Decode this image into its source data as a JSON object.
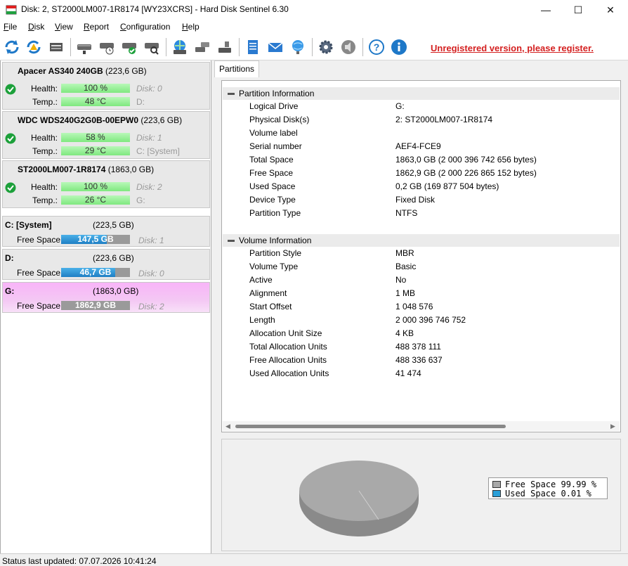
{
  "window": {
    "title": "Disk: 2, ST2000LM007-1R8174 [WY23XCRS]  -  Hard Disk Sentinel 6.30",
    "minimize_glyph": "—",
    "maximize_glyph": "☐",
    "close_glyph": "✕"
  },
  "menu": [
    {
      "first": "F",
      "rest": "ile"
    },
    {
      "first": "D",
      "rest": "isk"
    },
    {
      "first": "V",
      "rest": "iew"
    },
    {
      "first": "R",
      "rest": "eport"
    },
    {
      "first": "C",
      "rest": "onfiguration"
    },
    {
      "first": "H",
      "rest": "elp"
    }
  ],
  "toolbar": {
    "icons": [
      "refresh-icon",
      "refresh-warning-icon",
      "drive-icon",
      "disk-test-icon",
      "disk-schedule-icon",
      "disk-ok-icon",
      "disk-search-icon",
      "disk-globe-icon",
      "disk-export-icon",
      "disk-ide-icon",
      "report-icon",
      "email-icon",
      "network-icon",
      "settings-icon",
      "sound-icon",
      "help-icon",
      "info-icon"
    ],
    "register_text": "Unregistered version, please register."
  },
  "disks": [
    {
      "name": "Apacer AS340 240GB",
      "size": "(223,6 GB)",
      "health_label": "Health:",
      "health": "100 %",
      "health_pct": 100,
      "temp_label": "Temp.:",
      "temp": "48 °C",
      "disk_no": "Disk: 0",
      "letter": "D:"
    },
    {
      "name": "WDC WDS240G2G0B-00EPW0",
      "size": "(223,6 GB)",
      "health_label": "Health:",
      "health": "58 %",
      "health_pct": 58,
      "temp_label": "Temp.:",
      "temp": "29 °C",
      "disk_no": "Disk: 1",
      "letter": "C: [System]"
    },
    {
      "name": "ST2000LM007-1R8174",
      "size": "(1863,0 GB)",
      "health_label": "Health:",
      "health": "100 %",
      "health_pct": 100,
      "temp_label": "Temp.:",
      "temp": "26 °C",
      "disk_no": "Disk: 2",
      "letter": "G:"
    }
  ],
  "partitions": [
    {
      "name": "C: [System]",
      "size": "(223,5 GB)",
      "free_label": "Free Space",
      "free": "147,5 GB",
      "free_fraction": 0.66,
      "disk": "Disk: 1",
      "selected": false
    },
    {
      "name": "D:",
      "size": "(223,6 GB)",
      "free_label": "Free Space",
      "free": "46,7 GB",
      "free_fraction": 0.79,
      "disk": "Disk: 0",
      "selected": false
    },
    {
      "name": "G:",
      "size": "(1863,0 GB)",
      "free_label": "Free Space",
      "free": "1862,9 GB",
      "free_fraction": 0.0,
      "disk": "Disk: 2",
      "selected": true
    }
  ],
  "tab": "Partitions",
  "partition_info": {
    "header": "Partition Information",
    "rows": [
      {
        "k": "Logical Drive",
        "v": "G:"
      },
      {
        "k": "Physical Disk(s)",
        "v": "2: ST2000LM007-1R8174"
      },
      {
        "k": "Volume label",
        "v": ""
      },
      {
        "k": "Serial number",
        "v": "AEF4-FCE9"
      },
      {
        "k": "Total Space",
        "v": "1863,0 GB (2 000 396 742 656 bytes)"
      },
      {
        "k": "Free Space",
        "v": "1862,9 GB (2 000 226 865 152 bytes)"
      },
      {
        "k": "Used Space",
        "v": "0,2 GB (169 877 504 bytes)"
      },
      {
        "k": "Device Type",
        "v": "Fixed Disk"
      },
      {
        "k": "Partition Type",
        "v": "NTFS"
      }
    ]
  },
  "volume_info": {
    "header": "Volume Information",
    "rows": [
      {
        "k": "Partition Style",
        "v": "MBR"
      },
      {
        "k": "Volume Type",
        "v": "Basic"
      },
      {
        "k": "Active",
        "v": "No"
      },
      {
        "k": "Alignment",
        "v": "1 MB"
      },
      {
        "k": "Start Offset",
        "v": "1 048 576"
      },
      {
        "k": "Length",
        "v": "2 000 396 746 752"
      },
      {
        "k": "Allocation Unit Size",
        "v": "4 KB"
      },
      {
        "k": "Total Allocation Units",
        "v": "488 378 111"
      },
      {
        "k": "Free Allocation Units",
        "v": "488 336 637"
      },
      {
        "k": "Used Allocation Units",
        "v": "41 474"
      }
    ]
  },
  "space_chart": {
    "legend": [
      {
        "label": "Free Space",
        "value": "99.99 %",
        "color": "#a8a8a8"
      },
      {
        "label": "Used Space",
        "value": " 0.01 %",
        "color": "#2a9fd8"
      }
    ]
  },
  "status": "Status last updated: 07.07.2026 10:41:24"
}
